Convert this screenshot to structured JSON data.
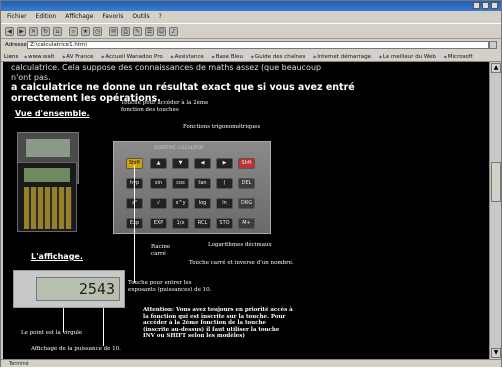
{
  "menu": [
    "Fichier",
    "Edition",
    "Affichage",
    "Favoris",
    "Outils",
    "?"
  ],
  "address": {
    "label": "Adresse",
    "value": "Z:\\calculatrice1.html"
  },
  "links": {
    "label": "Liens",
    "items": [
      "www.walt",
      "AV France",
      "Accueil Wanadoo Pro",
      "Assistance",
      "Base Bleu",
      "Guide des chaînes",
      "Internet démarrage",
      "Le meilleur du Web",
      "Microsoft"
    ]
  },
  "content": {
    "intro1": "calculatrice. Cela suppose des connaissances de maths assez (que beaucoup",
    "intro2": "n'ont pas.",
    "big1": "a calculatrice ne donne un résultat exact que si vous avez entré",
    "big2": "orrectement les opérations.",
    "vue_heading": "Vue d'ensemble.",
    "aff_heading": "L'affichage.",
    "display_value": "2543",
    "calc_brand": "SCIENTIFIC CALCULATOR",
    "keys_row1": [
      "Shift",
      "▲",
      "▼",
      "◀",
      "▶",
      "Shft"
    ],
    "keys_row2": [
      "hyp",
      "sin",
      "cos",
      "tan",
      "(",
      "DEL"
    ],
    "keys_row3": [
      "x²",
      "√",
      "x^y",
      "log",
      "ln",
      "DRG"
    ],
    "keys_row4": [
      "Exp",
      "EXP",
      "1/x",
      "RCL",
      "STO",
      "M+"
    ],
    "ann_shift": "Touche pour accéder à la 2ème fonction des touches",
    "ann_trig": "Fonctions trigonométriques",
    "ann_log": "Logarithmes décimaux",
    "ann_sqrt": "Racine carré",
    "ann_square": "Touche carré et inverse d'un nombre.",
    "ann_exp": "Touche pour entrer les exposants (puissances) de 10.",
    "ann_attention": "Attention: Vous avez toujours en priorité accès à la fonction qui est inscrite sur la touche. Pour accéder à la 2ème fonction de la touche (inscrite au-dessus) il faut utiliser la touche INV ou SHIFT selon les modèles)",
    "ann_virgule": "Le point est la virgule",
    "ann_puissance": "Affichage de la puissance de 10."
  },
  "status": "Terminé"
}
